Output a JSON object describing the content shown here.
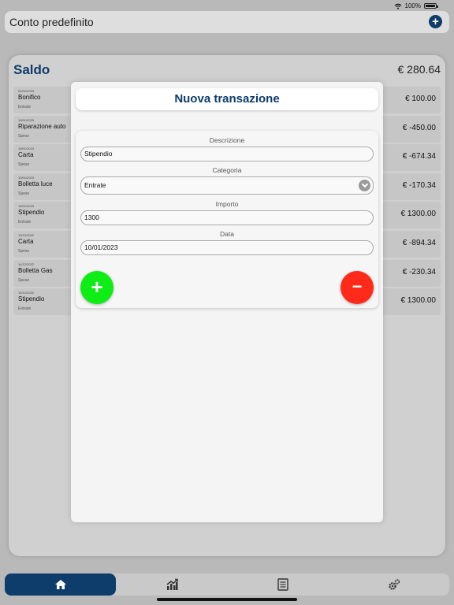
{
  "status": {
    "battery": "100%",
    "battery_level": 1.0
  },
  "header": {
    "title": "Conto predefinito"
  },
  "balance": {
    "label": "Saldo",
    "value": "€ 280.64"
  },
  "transactions": [
    {
      "date": "02/02/2023",
      "description": "Bonifico",
      "category": "Entrate",
      "amount": "€ 100.00"
    },
    {
      "date": "15/01/2023",
      "description": "Riparazione auto",
      "category": "Spese",
      "amount": "€ -450.00"
    },
    {
      "date": "15/01/2023",
      "description": "Carta",
      "category": "Spese",
      "amount": "€ -674.34"
    },
    {
      "date": "13/01/2023",
      "description": "Bolletta luce",
      "category": "Spese",
      "amount": "€ -170.34"
    },
    {
      "date": "10/01/2023",
      "description": "Stipendio",
      "category": "Entrate",
      "amount": "€ 1300.00"
    },
    {
      "date": "15/12/2022",
      "description": "Carta",
      "category": "Spese",
      "amount": "€ -894.34"
    },
    {
      "date": "14/12/2022",
      "description": "Bolletta Gas",
      "category": "Spese",
      "amount": "€ -230.34"
    },
    {
      "date": "10/12/2022",
      "description": "Stipendio",
      "category": "Entrate",
      "amount": "€ 1300.00"
    }
  ],
  "modal": {
    "title": "Nuova transazione",
    "fields": {
      "description_label": "Descrizione",
      "description_value": "Stipendio",
      "category_label": "Categoria",
      "category_value": "Entrate",
      "amount_label": "Importo",
      "amount_value": "1300",
      "date_label": "Data",
      "date_value": "10/01/2023"
    },
    "add_symbol": "+",
    "subtract_symbol": "−"
  },
  "tabs": [
    {
      "icon": "home-icon",
      "active": true
    },
    {
      "icon": "chart-icon",
      "active": false
    },
    {
      "icon": "list-icon",
      "active": false
    },
    {
      "icon": "gear-icon",
      "active": false
    }
  ],
  "colors": {
    "brand": "#0e3d6b",
    "add": "#0eee16",
    "subtract": "#ff2a1a"
  }
}
